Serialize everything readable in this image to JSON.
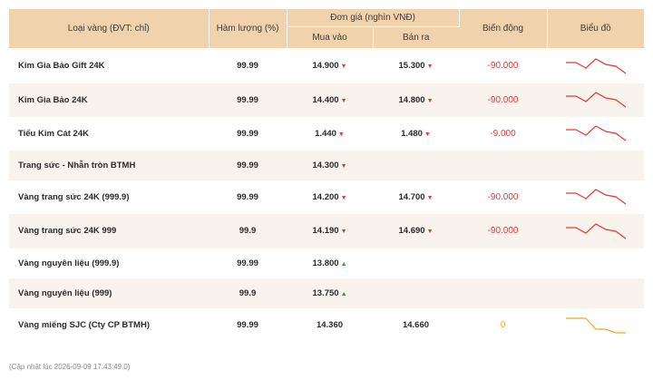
{
  "headers": {
    "type": "Loại vàng (ĐVT: chỉ)",
    "purity": "Hàm lượng (%)",
    "price_group": "Đơn giá (nghìn VNĐ)",
    "buy": "Mua vào",
    "sell": "Bán ra",
    "change": "Biến động",
    "chart": "Biểu đồ"
  },
  "rows": [
    {
      "name": "Kim Gia Bảo Gift 24K",
      "purity": "99.99",
      "buy": "14.900",
      "buy_dir": "▼",
      "sell": "15.300",
      "sell_dir": "▼",
      "change": "-90.000",
      "trend": "down",
      "spark": [
        3,
        3,
        6,
        1,
        4,
        5,
        9
      ]
    },
    {
      "name": "Kim Gia Bảo 24K",
      "purity": "99.99",
      "buy": "14.400",
      "buy_dir": "▼",
      "sell": "14.800",
      "sell_dir": "▼",
      "change": "-90.000",
      "trend": "down",
      "spark": [
        3,
        3,
        6,
        1,
        4,
        5,
        9
      ]
    },
    {
      "name": "Tiểu Kim Cát 24K",
      "purity": "99.99",
      "buy": "1.440",
      "buy_dir": "▼",
      "sell": "1.480",
      "sell_dir": "▼",
      "change": "-9.000",
      "trend": "down",
      "spark": [
        3,
        3,
        6,
        1,
        4,
        5,
        9
      ]
    },
    {
      "name": "Trang sức - Nhẫn tròn BTMH",
      "purity": "99.99",
      "buy": "14.300",
      "buy_dir": "▼",
      "sell": "",
      "sell_dir": "",
      "change": "",
      "trend": "",
      "spark": []
    },
    {
      "name": "Vàng trang sức 24K (999.9)",
      "purity": "99.99",
      "buy": "14.200",
      "buy_dir": "▼",
      "sell": "14.700",
      "sell_dir": "▼",
      "change": "-90.000",
      "trend": "down",
      "spark": [
        3,
        3,
        6,
        1,
        4,
        5,
        9
      ]
    },
    {
      "name": "Vàng trang sức 24K 999",
      "purity": "99.9",
      "buy": "14.190",
      "buy_dir": "▼",
      "sell": "14.690",
      "sell_dir": "▼",
      "change": "-90.000",
      "trend": "down",
      "spark": [
        3,
        3,
        6,
        1,
        4,
        5,
        9
      ]
    },
    {
      "name": "Vàng nguyên liệu (999.9)",
      "purity": "99.99",
      "buy": "13.800",
      "buy_dir": "▲",
      "sell": "",
      "sell_dir": "",
      "change": "",
      "trend": "",
      "spark": []
    },
    {
      "name": "Vàng nguyên liệu (999)",
      "purity": "99.9",
      "buy": "13.750",
      "buy_dir": "▲",
      "sell": "",
      "sell_dir": "",
      "change": "",
      "trend": "",
      "spark": []
    },
    {
      "name": "Vàng miếng SJC (Cty CP BTMH)",
      "purity": "99.99",
      "buy": "14.360",
      "buy_dir": "",
      "sell": "14.660",
      "sell_dir": "",
      "change": "0",
      "trend": "flat",
      "spark": [
        1,
        1,
        1,
        7,
        7,
        9,
        9
      ]
    }
  ],
  "footer": "(Cập nhật lúc 2026-09-09 17:43:49.0)",
  "colors": {
    "header_bg": "#f0d3ad",
    "row_shade": "#f8f3ec",
    "down": "#e53935",
    "up": "#2e9a3a",
    "flat": "#f5a623"
  }
}
